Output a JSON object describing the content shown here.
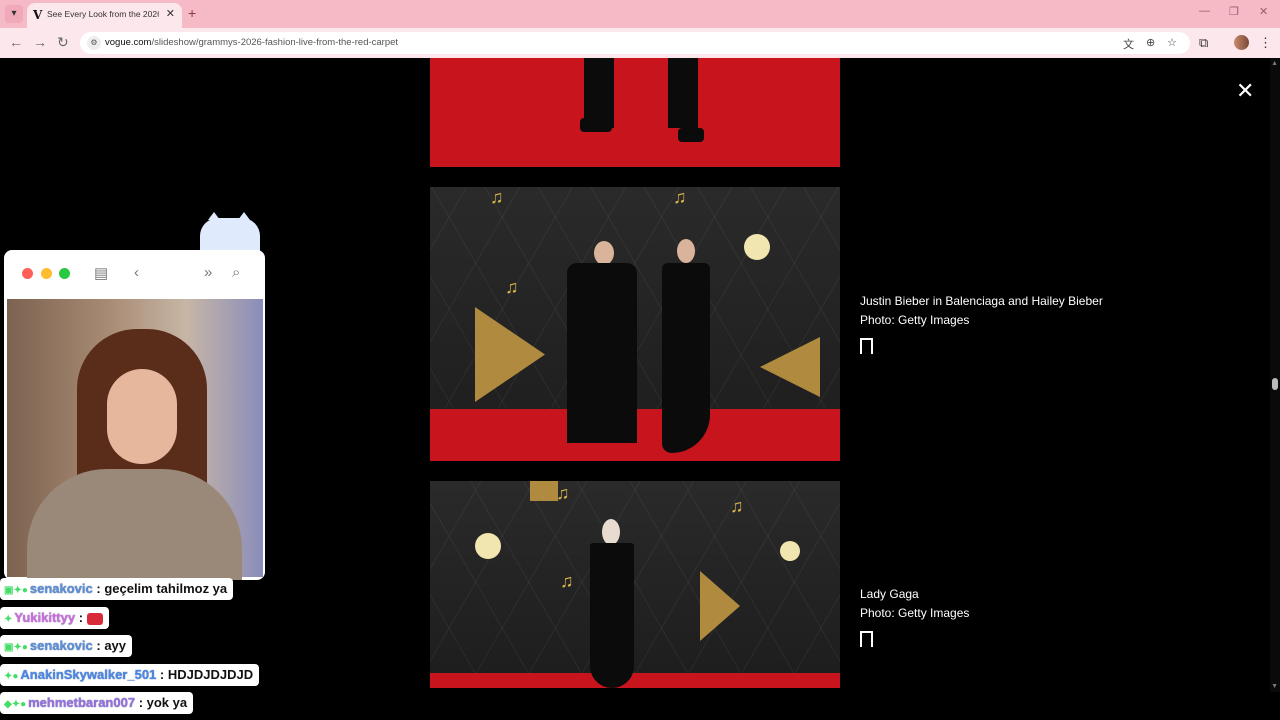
{
  "browser": {
    "tab_title": "See Every Look from the 2026 G",
    "tab_favicon": "V",
    "url_domain": "vogue.com",
    "url_path": "/slideshow/grammys-2026-fashion-live-from-the-red-carpet"
  },
  "slideshow": {
    "slides": [
      {
        "caption": "Justin Bieber in Balenciaga and Hailey Bieber",
        "credit": "Photo: Getty Images"
      },
      {
        "caption": "Lady Gaga",
        "credit": "Photo: Getty Images"
      }
    ]
  },
  "chat": {
    "messages": [
      {
        "user": "senakovic",
        "text": ": geçelim tahilmoz ya"
      },
      {
        "user": "Yukikittyy",
        "text": ":"
      },
      {
        "user": "senakovic",
        "text": ": ayy"
      },
      {
        "user": "AnakinSkywalker_501",
        "text": ": HDJDJDJDJD"
      },
      {
        "user": "mehmetbaran007",
        "text": ": yok ya"
      }
    ]
  },
  "colors": {
    "tabbar": "#f6b9c6",
    "toolbar": "#fce7ec",
    "carpet": "#c8141c",
    "page_bg": "#000000"
  }
}
